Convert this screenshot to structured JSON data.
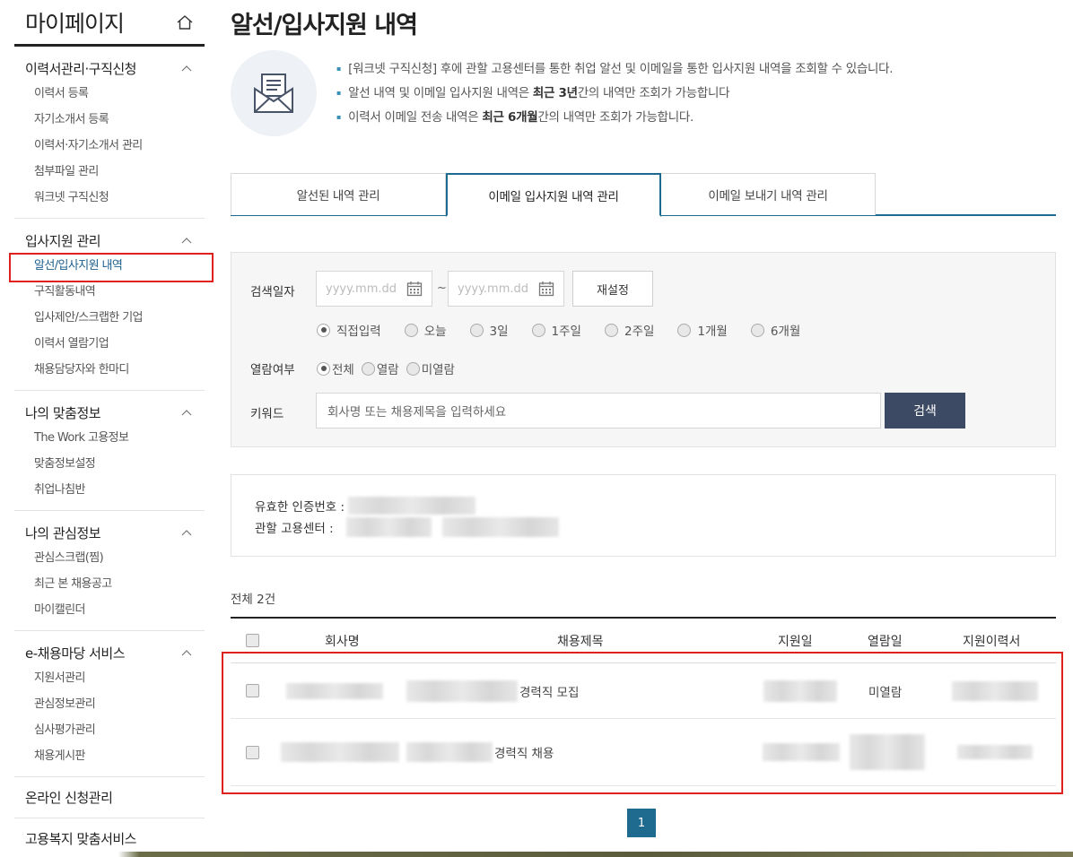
{
  "sidebar": {
    "title": "마이페이지",
    "sections": [
      {
        "title": "이력서관리·구직신청",
        "items": [
          "이력서 등록",
          "자기소개서 등록",
          "이력서·자기소개서 관리",
          "첨부파일 관리",
          "워크넷 구직신청"
        ]
      },
      {
        "title": "입사지원 관리",
        "items": [
          "알선/입사지원 내역",
          "구직활동내역",
          "입사제안/스크랩한 기업",
          "이력서 열람기업",
          "채용담당자와 한마디"
        ]
      },
      {
        "title": "나의 맞춤정보",
        "items": [
          "The Work 고용정보",
          "맞춤정보설정",
          "취업나침반"
        ]
      },
      {
        "title": "나의 관심정보",
        "items": [
          "관심스크랩(찜)",
          "최근 본 채용공고",
          "마이캘린더"
        ]
      },
      {
        "title": "e-채용마당 서비스",
        "items": [
          "지원서관리",
          "관심정보관리",
          "심사평가관리",
          "채용게시판"
        ]
      }
    ],
    "single_items": [
      "온라인 신청관리",
      "고용복지 맞춤서비스"
    ]
  },
  "page": {
    "title": "알선/입사지원 내역",
    "intro": {
      "line1": "[워크넷 구직신청] 후에 관할 고용센터를 통한 취업 알선 및 이메일을 통한 입사지원 내역을 조회할 수 있습니다.",
      "line2_pre": "알선 내역 및 이메일 입사지원 내역은 ",
      "line2_bold": "최근 3년",
      "line2_post": "간의 내역만 조회가 가능합니다",
      "line3_pre": "이력서 이메일 전송 내역은 ",
      "line3_bold": "최근 6개월",
      "line3_post": "간의 내역만 조회가 가능합니다."
    }
  },
  "tabs": [
    "알선된 내역 관리",
    "이메일 입사지원 내역 관리",
    "이메일 보내기 내역 관리"
  ],
  "search": {
    "date_label": "검색일자",
    "date_placeholder": "yyyy.mm.dd",
    "tilde": "~",
    "reset_label": "재설정",
    "period_options": [
      "직접입력",
      "오늘",
      "3일",
      "1주일",
      "2주일",
      "1개월",
      "6개월"
    ],
    "view_label": "열람여부",
    "view_options": [
      "전체",
      "열람",
      "미열람"
    ],
    "keyword_label": "키워드",
    "keyword_placeholder": "회사명 또는 채용제목을 입력하세요",
    "search_label": "검색"
  },
  "info": {
    "cert_label": "유효한 인증번호 :",
    "center_label": "관할 고용센터 :"
  },
  "table": {
    "total": "전체 2건",
    "headers": [
      "회사명",
      "채용제목",
      "지원일",
      "열람일",
      "지원이력서"
    ],
    "rows": [
      {
        "title_suffix": "경력직 모집",
        "view_status": "미열람"
      },
      {
        "title_suffix": "경력직 채용",
        "view_status": ""
      }
    ]
  },
  "pagination": {
    "current": "1"
  }
}
